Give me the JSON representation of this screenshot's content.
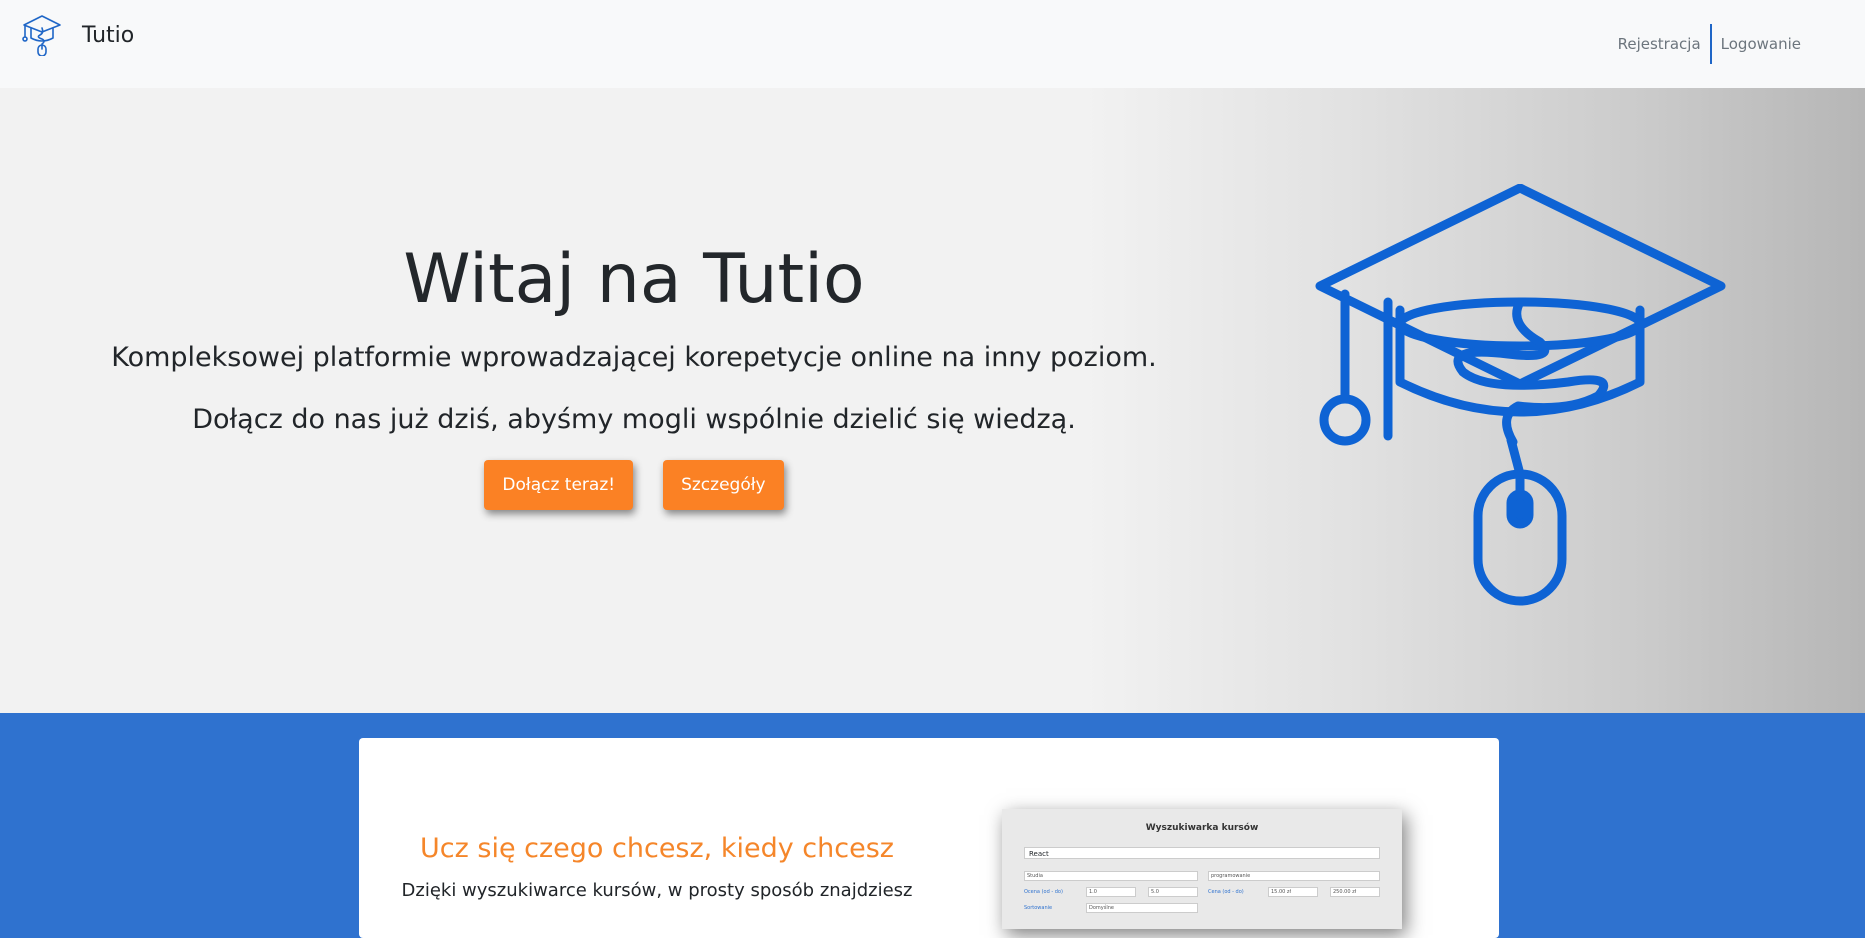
{
  "navbar": {
    "brand": "Tutio",
    "links": [
      "Rejestracja",
      "Logowanie"
    ]
  },
  "hero": {
    "title": "Witaj na Tutio",
    "line1": "Kompleksowej platformie wprowadzającej korepetycje online na inny poziom.",
    "line2": "Dołącz do nas już dziś, abyśmy mogli wspólnie dzielić się wiedzą.",
    "join_button": "Dołącz teraz!",
    "details_button": "Szczegóły"
  },
  "feature": {
    "title": "Ucz się czego chcesz, kiedy chcesz",
    "text": "Dzięki wyszukiwarce kursów, w prosty sposób znajdziesz",
    "screenshot": {
      "title": "Wyszukiwarka kursów",
      "search_value": "React",
      "select_value": "Studia",
      "tag_value": "programowanie",
      "row1_label_left": "Ocena (od - do)",
      "row1_val_a": "1.0",
      "row1_val_b": "5.0",
      "row1_label_right": "Cena (od - do)",
      "row1_val_c": "15.00 zł",
      "row1_val_d": "250.00 zł",
      "row2_label": "Sortowanie",
      "row2_value": "Domyślne"
    }
  },
  "colors": {
    "accent": "#fb8124",
    "primary": "#1f66c7",
    "section_blue": "#2f72cf"
  }
}
